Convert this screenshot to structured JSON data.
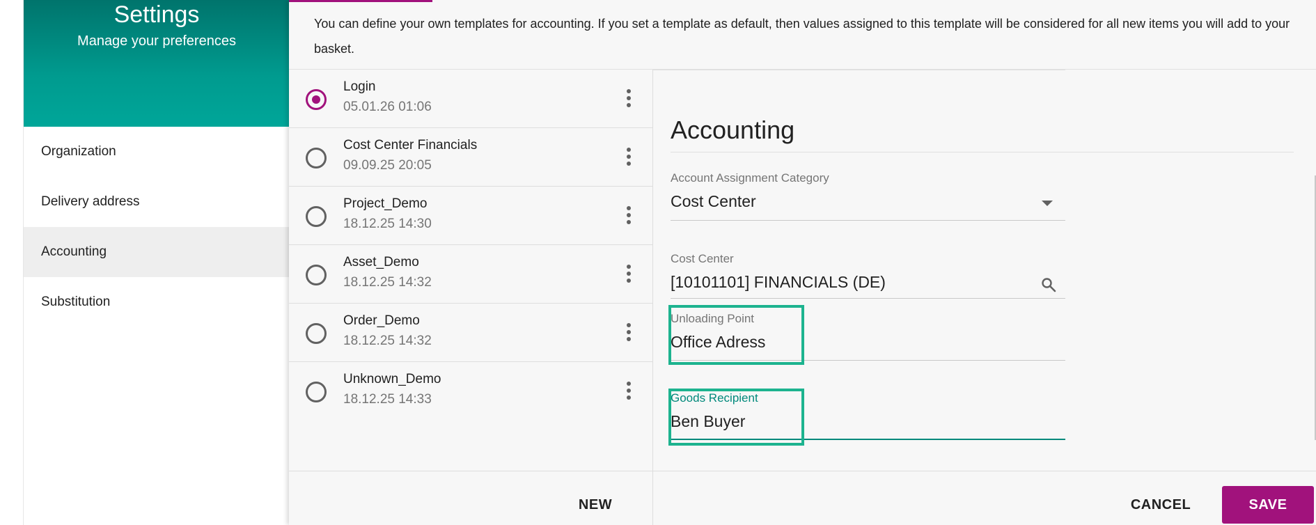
{
  "sidebar": {
    "title": "Settings",
    "subtitle": "Manage your preferences",
    "items": [
      {
        "label": "Organization"
      },
      {
        "label": "Delivery address"
      },
      {
        "label": "Accounting"
      },
      {
        "label": "Substitution"
      }
    ],
    "active": "Accounting"
  },
  "main": {
    "info_text": "You can define your own templates for accounting. If you set a template as default, then values assigned to this template will be considered for all new items you will add to your basket."
  },
  "templates": [
    {
      "name": "Login",
      "date": "05.01.26 01:06",
      "selected": true
    },
    {
      "name": "Cost Center Financials",
      "date": "09.09.25 20:05",
      "selected": false
    },
    {
      "name": "Project_Demo",
      "date": "18.12.25 14:30",
      "selected": false
    },
    {
      "name": "Asset_Demo",
      "date": "18.12.25 14:32",
      "selected": false
    },
    {
      "name": "Order_Demo",
      "date": "18.12.25 14:32",
      "selected": false
    },
    {
      "name": "Unknown_Demo",
      "date": "18.12.25 14:33",
      "selected": false
    }
  ],
  "form": {
    "title": "Accounting",
    "account_assignment": {
      "label": "Account Assignment Category",
      "value": "Cost Center"
    },
    "cost_center": {
      "label": "Cost Center",
      "value": "[10101101] FINANCIALS (DE)"
    },
    "unloading_point": {
      "label": "Unloading Point",
      "value": "Office Adress"
    },
    "goods_recipient": {
      "label": "Goods Recipient",
      "value": "Ben Buyer"
    }
  },
  "footer": {
    "new_label": "NEW",
    "cancel_label": "CANCEL",
    "save_label": "SAVE"
  },
  "colors": {
    "accent": "#a1127c",
    "header_teal": "#009b8f",
    "focus": "#00897b",
    "highlight": "#1db38f"
  }
}
